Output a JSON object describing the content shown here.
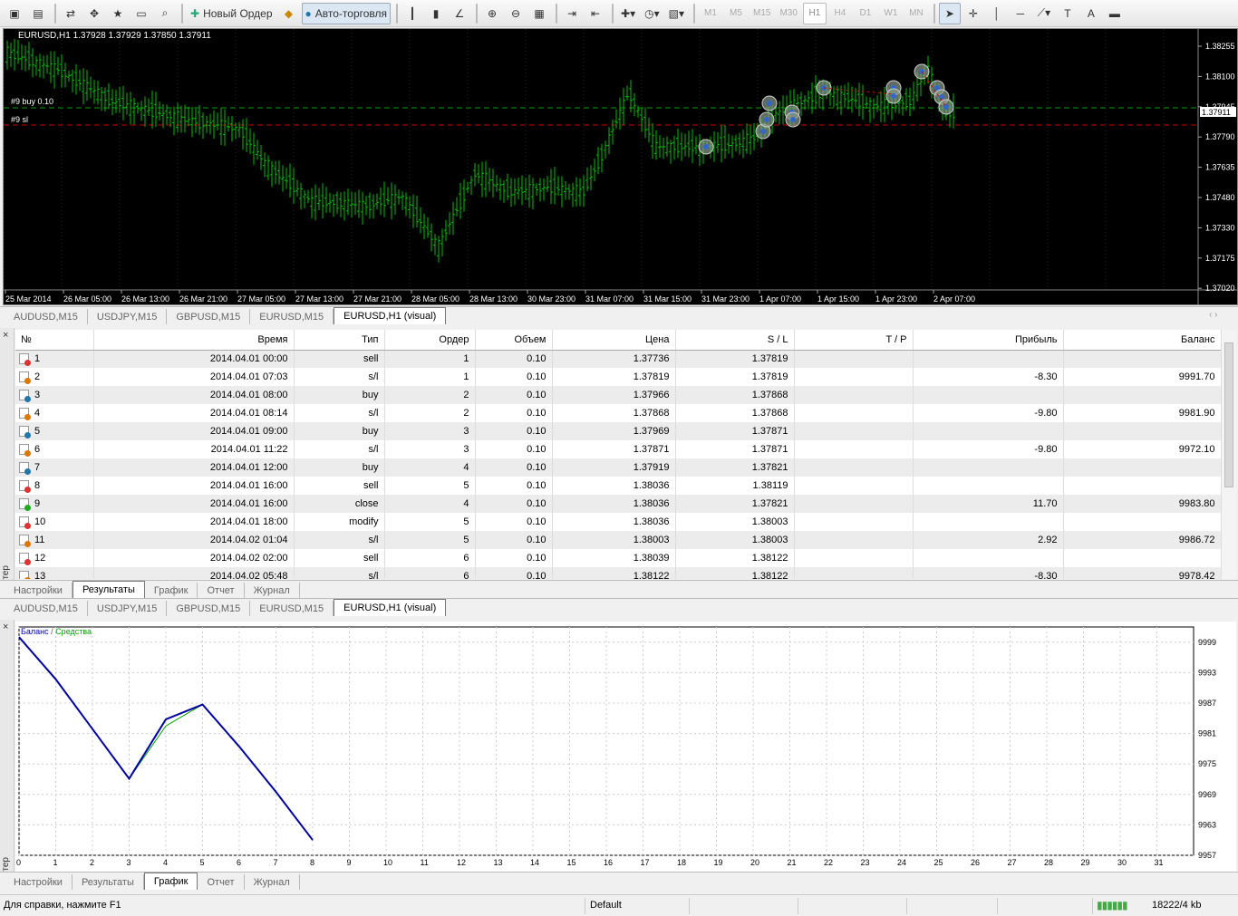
{
  "toolbar": {
    "new_order": "Новый Ордер",
    "auto_trading": "Авто-торговля",
    "timeframes": [
      "M1",
      "M5",
      "M15",
      "M30",
      "H1",
      "H4",
      "D1",
      "W1",
      "MN"
    ],
    "active_timeframe": "H1"
  },
  "chart": {
    "header": "EURUSD,H1  1.37928 1.37929 1.37850 1.37911",
    "order_label": "#9 buy 0.10",
    "sl_label": "#9 sl",
    "price_labels": [
      "1.38255",
      "1.38100",
      "1.37945",
      "1.37790",
      "1.37635",
      "1.37480",
      "1.37330",
      "1.37175",
      "1.37020"
    ],
    "current_price": "1.37911",
    "time_labels": [
      "25 Mar 2014",
      "26 Mar 05:00",
      "26 Mar 13:00",
      "26 Mar 21:00",
      "27 Mar 05:00",
      "27 Mar 13:00",
      "27 Mar 21:00",
      "28 Mar 05:00",
      "28 Mar 13:00",
      "30 Mar 23:00",
      "31 Mar 07:00",
      "31 Mar 15:00",
      "31 Mar 23:00",
      "1 Apr 07:00",
      "1 Apr 15:00",
      "1 Apr 23:00",
      "2 Apr 07:00"
    ],
    "colors": {
      "bar": "#00c000",
      "bg": "#000000",
      "grid": "#2a2a2a",
      "order_line": "#00a000",
      "sl_line": "#c00000"
    }
  },
  "chart_tabs": [
    "AUDUSD,M15",
    "USDJPY,M15",
    "GBPUSD,M15",
    "EURUSD,M15",
    "EURUSD,H1 (visual)"
  ],
  "results": {
    "headers": [
      "№",
      "Время",
      "Тип",
      "Ордер",
      "Объем",
      "Цена",
      "S / L",
      "T / P",
      "Прибыль",
      "Баланс"
    ],
    "rows": [
      [
        "1",
        "2014.04.01 00:00",
        "sell",
        "1",
        "0.10",
        "1.37736",
        "1.37819",
        "",
        "",
        ""
      ],
      [
        "2",
        "2014.04.01 07:03",
        "s/l",
        "1",
        "0.10",
        "1.37819",
        "1.37819",
        "",
        "-8.30",
        "9991.70"
      ],
      [
        "3",
        "2014.04.01 08:00",
        "buy",
        "2",
        "0.10",
        "1.37966",
        "1.37868",
        "",
        "",
        ""
      ],
      [
        "4",
        "2014.04.01 08:14",
        "s/l",
        "2",
        "0.10",
        "1.37868",
        "1.37868",
        "",
        "-9.80",
        "9981.90"
      ],
      [
        "5",
        "2014.04.01 09:00",
        "buy",
        "3",
        "0.10",
        "1.37969",
        "1.37871",
        "",
        "",
        ""
      ],
      [
        "6",
        "2014.04.01 11:22",
        "s/l",
        "3",
        "0.10",
        "1.37871",
        "1.37871",
        "",
        "-9.80",
        "9972.10"
      ],
      [
        "7",
        "2014.04.01 12:00",
        "buy",
        "4",
        "0.10",
        "1.37919",
        "1.37821",
        "",
        "",
        ""
      ],
      [
        "8",
        "2014.04.01 16:00",
        "sell",
        "5",
        "0.10",
        "1.38036",
        "1.38119",
        "",
        "",
        ""
      ],
      [
        "9",
        "2014.04.01 16:00",
        "close",
        "4",
        "0.10",
        "1.38036",
        "1.37821",
        "",
        "11.70",
        "9983.80"
      ],
      [
        "10",
        "2014.04.01 18:00",
        "modify",
        "5",
        "0.10",
        "1.38036",
        "1.38003",
        "",
        "",
        ""
      ],
      [
        "11",
        "2014.04.02 01:04",
        "s/l",
        "5",
        "0.10",
        "1.38003",
        "1.38003",
        "",
        "2.92",
        "9986.72"
      ],
      [
        "12",
        "2014.04.02 02:00",
        "sell",
        "6",
        "0.10",
        "1.38039",
        "1.38122",
        "",
        "",
        ""
      ],
      [
        "13",
        "2014.04.02 05:48",
        "s/l",
        "6",
        "0.10",
        "1.38122",
        "1.38122",
        "",
        "-8.30",
        "9978.42"
      ]
    ]
  },
  "tester_tabs": [
    "Настройки",
    "Результаты",
    "График",
    "Отчет",
    "Журнал"
  ],
  "tester_label": "Тестер",
  "graph": {
    "legend_balance": "Баланс",
    "legend_equity": "Средства",
    "legend_sep": "/",
    "y_labels": [
      "9999",
      "9993",
      "9987",
      "9981",
      "9975",
      "9969",
      "9963",
      "9957"
    ],
    "x_labels": [
      "0",
      "1",
      "2",
      "3",
      "4",
      "5",
      "6",
      "7",
      "8",
      "9",
      "10",
      "11",
      "12",
      "13",
      "14",
      "15",
      "16",
      "17",
      "18",
      "19",
      "20",
      "21",
      "22",
      "23",
      "24",
      "25",
      "26",
      "27",
      "28",
      "29",
      "30",
      "31"
    ],
    "balance_color": "#0000a0",
    "equity_color": "#00a000"
  },
  "chart_data": {
    "type": "line",
    "title": "",
    "xlabel": "",
    "ylabel": "",
    "x": [
      0,
      1,
      2,
      3,
      4,
      5,
      6,
      7,
      8
    ],
    "ylim": [
      9957,
      10002
    ],
    "xlim": [
      0,
      32
    ],
    "series": [
      {
        "name": "Баланс",
        "values": [
          10000,
          9991.7,
          9981.9,
          9972.1,
          9983.8,
          9986.72,
          9978.42,
          9969.5,
          9960.0
        ]
      },
      {
        "name": "Средства",
        "values": [
          10000,
          9991.7,
          9981.9,
          9972.1,
          9982.5,
          9986.72,
          9978.42,
          9969.5,
          9960.0
        ]
      }
    ]
  },
  "status": {
    "help": "Для справки, нажмите F1",
    "profile": "Default",
    "traffic": "18222/4 kb"
  }
}
